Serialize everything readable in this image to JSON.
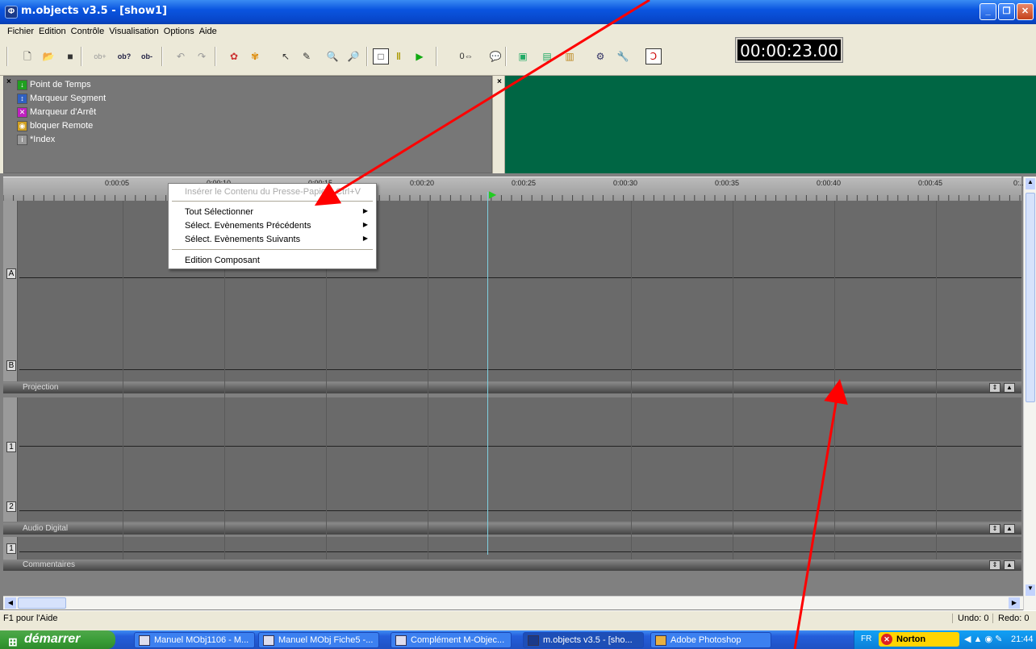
{
  "window": {
    "title": "m.objects v3.5 - [show1]",
    "min_label": "_",
    "max_label": "❐",
    "close_label": "✕"
  },
  "menu": [
    "Fichier",
    "Edition",
    "Contrôle",
    "Visualisation",
    "Options",
    "Aide"
  ],
  "timecode": "00:00:23.00",
  "legend": [
    {
      "label": "Point de Temps",
      "icon": "arrow-down-icon",
      "color": "#20a020"
    },
    {
      "label": "Marqueur Segment",
      "icon": "segment-marker-icon",
      "color": "#3060c0"
    },
    {
      "label": "Marqueur d'Arrêt",
      "icon": "stop-marker-icon",
      "color": "#c020c0"
    },
    {
      "label": "bloquer Remote",
      "icon": "lock-remote-icon",
      "color": "#d0a020"
    },
    {
      "label": "*Index",
      "icon": "index-icon",
      "color": "#666"
    }
  ],
  "ruler_labels": [
    "0:00:05",
    "0:00:10",
    "0:00:15",
    "0:00:20",
    "0:00:25",
    "0:00:30",
    "0:00:35",
    "0:00:40",
    "0:00:45",
    "0:..."
  ],
  "context_menu": {
    "paste": "Insérer le Contenu du Presse-Papiers",
    "paste_shortcut": "Ctrl+V",
    "select_all": "Tout Sélectionner",
    "select_prev": "Sélect. Evènements Précédents",
    "select_next": "Sélect. Evènements Suivants",
    "edit_component": "Edition Composant"
  },
  "tracks": {
    "projection": {
      "label": "Projection",
      "lanes": [
        "A",
        "B"
      ]
    },
    "audio": {
      "label": "Audio Digital",
      "lanes": [
        "1",
        "2"
      ]
    },
    "comments": {
      "label": "Commentaires",
      "lanes": [
        "1"
      ]
    }
  },
  "status": {
    "help": "F1 pour l'Aide",
    "undo": "Undo: 0",
    "redo": "Redo: 0"
  },
  "taskbar": {
    "start": "démarrer",
    "tasks": [
      "Manuel MObj1106 - M...",
      "Manuel MObj Fiche5 -...",
      "Complément M-Objec...",
      "m.objects v3.5 - [sho...",
      "Adobe Photoshop"
    ],
    "lang": "FR",
    "norton": "Norton",
    "clock": "21:44"
  },
  "colors": {
    "preview_bg": "#006644",
    "annotation_arrow": "#ff0000"
  }
}
